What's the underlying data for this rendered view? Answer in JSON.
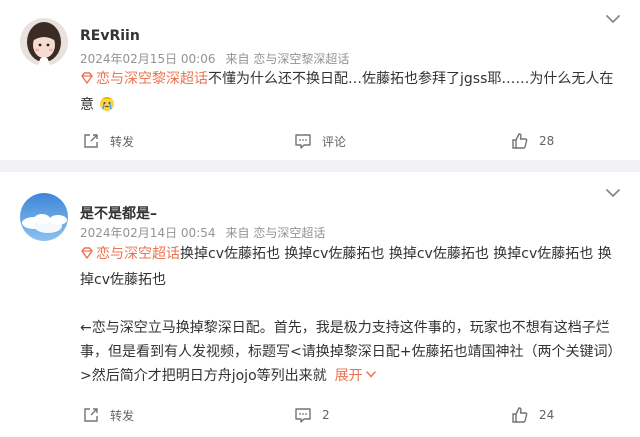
{
  "comments": [
    {
      "username": "REvRiin",
      "date": "2024年02月15日 00:06",
      "source_prefix": "来自",
      "source": "恋与深空黎深超话",
      "topic": "恋与深空黎深超话",
      "text": "不懂为什么还不换日配…佐藤拓也参拜了jgss耶……为什么无人在意",
      "emoji_icon": "crying-face-emoji-icon",
      "repost_label": "转发",
      "comment_label": "评论",
      "likes": "28"
    },
    {
      "username": "是不是都是–",
      "date": "2024年02月14日 00:54",
      "source_prefix": "来自",
      "source": "恋与深空超话",
      "topic": "恋与深空超话",
      "text": "换掉cv佐藤拓也 换掉cv佐藤拓也 换掉cv佐藤拓也 换掉cv佐藤拓也 换掉cv佐藤拓也",
      "text2": "←恋与深空立马换掉黎深日配。首先，我是极力支持这件事的，玩家也不想有这档子烂事，但是看到有人发视频，标题写<请换掉黎深日配+佐藤拓也靖国神社（两个关键词）>然后简介才把明日方舟jojo等列出来就",
      "expand_label": "展开",
      "repost_label": "转发",
      "comment_count": "2",
      "likes": "24"
    }
  ],
  "colors": {
    "accent": "#eb7350",
    "meta_text": "#939393",
    "body_text": "#333333",
    "background": "#f1f2f5"
  }
}
